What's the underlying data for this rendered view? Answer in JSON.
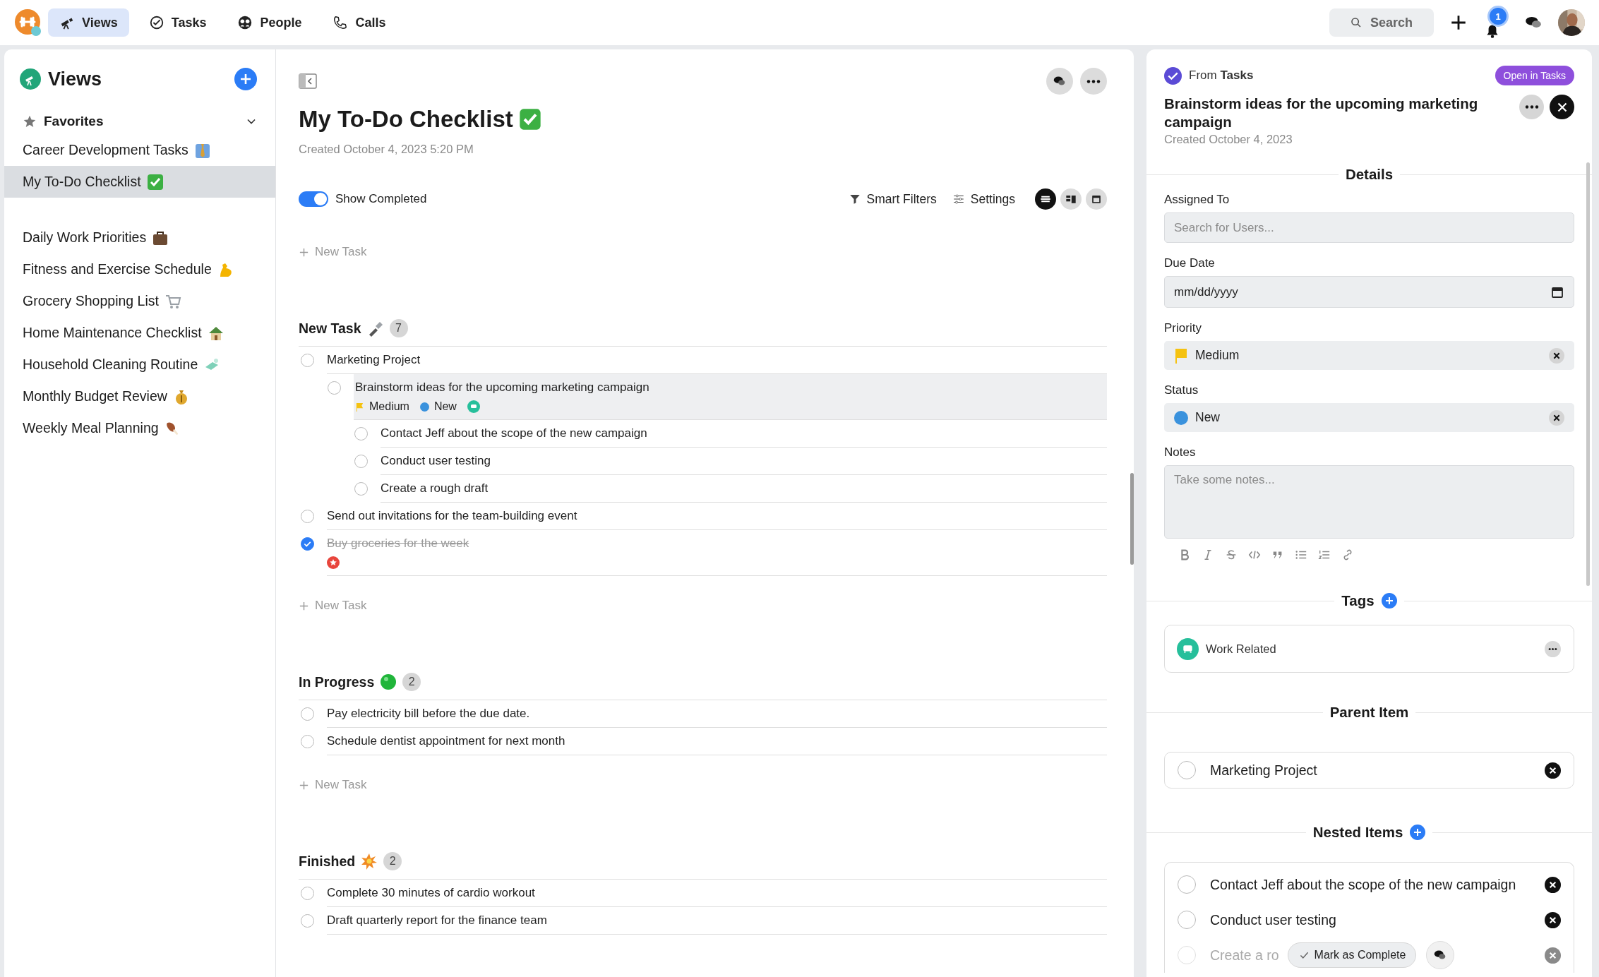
{
  "top_nav": {
    "tabs": [
      {
        "label": "Views",
        "selected": true
      },
      {
        "label": "Tasks",
        "selected": false
      },
      {
        "label": "People",
        "selected": false
      },
      {
        "label": "Calls",
        "selected": false
      }
    ],
    "search": {
      "label": "Search"
    },
    "notification_count": "1"
  },
  "sidebar": {
    "title": "Views",
    "favorites": {
      "label": "Favorites",
      "expanded": true,
      "items": [
        {
          "label": "Career Development Tasks",
          "selected": false
        },
        {
          "label": "My To-Do Checklist",
          "selected": true
        }
      ]
    },
    "items": [
      {
        "label": "Daily Work Priorities",
        "selected": false
      },
      {
        "label": "Fitness and Exercise Schedule",
        "selected": false
      },
      {
        "label": "Grocery Shopping List",
        "selected": false
      },
      {
        "label": "Home Maintenance Checklist",
        "selected": false
      },
      {
        "label": "Household Cleaning Routine",
        "selected": false
      },
      {
        "label": "Monthly Budget Review",
        "selected": false
      },
      {
        "label": "Weekly Meal Planning",
        "selected": false
      }
    ]
  },
  "list": {
    "title": "My To-Do Checklist",
    "created": "Created October 4, 2023 5:20 PM",
    "show_completed": {
      "label": "Show Completed",
      "on": true
    },
    "smart_filters": "Smart Filters",
    "settings": "Settings",
    "view_modes": [
      {
        "selected": true
      },
      {
        "selected": false
      },
      {
        "selected": false
      }
    ],
    "new_task": "New Task",
    "groups": [
      {
        "title": "New Task",
        "count": "7",
        "new_task": "New Task",
        "tasks": [
          {
            "title": "Marketing Project",
            "checked": false,
            "selected": false,
            "important": false,
            "children": [
              {
                "title": "Brainstorm ideas for the upcoming marketing campaign",
                "checked": false,
                "selected": true,
                "important": false,
                "priority": {
                  "label": "Medium",
                  "color": "#f5c211"
                },
                "status": {
                  "label": "New",
                  "color": "#3a92dd"
                },
                "tags": [
                  {
                    "color": "#26bf9b"
                  }
                ],
                "children": [
                  {
                    "title": "Contact Jeff about the scope of the new campaign",
                    "checked": false,
                    "selected": false,
                    "important": false
                  },
                  {
                    "title": "Conduct user testing",
                    "checked": false,
                    "selected": false,
                    "important": false
                  },
                  {
                    "title": "Create a rough draft",
                    "checked": false,
                    "selected": false,
                    "important": false
                  }
                ]
              }
            ]
          },
          {
            "title": "Send out invitations for the team-building event",
            "checked": false,
            "selected": false,
            "important": false
          },
          {
            "title": "Buy groceries for the week",
            "checked": true,
            "selected": false,
            "important": true
          }
        ]
      },
      {
        "title": "In Progress",
        "count": "2",
        "new_task": "New Task",
        "tasks": [
          {
            "title": "Pay electricity bill before the due date.",
            "checked": false,
            "selected": false,
            "important": false
          },
          {
            "title": "Schedule dentist appointment for next month",
            "checked": false,
            "selected": false,
            "important": false
          }
        ]
      },
      {
        "title": "Finished",
        "count": "2",
        "tasks": [
          {
            "title": "Complete 30 minutes of cardio workout",
            "checked": false,
            "selected": false,
            "important": false
          },
          {
            "title": "Draft quarterly report for the finance team",
            "checked": false,
            "selected": false,
            "important": false
          }
        ]
      }
    ]
  },
  "detail": {
    "source_prefix": "From",
    "source_app": "Tasks",
    "open_button": "Open in Tasks",
    "title": "Brainstorm ideas for the upcoming marketing campaign",
    "created": "Created October 4, 2023",
    "details_heading": "Details",
    "assigned_to": {
      "label": "Assigned To",
      "placeholder": "Search for Users..."
    },
    "due_date": {
      "label": "Due Date",
      "placeholder": "mm/dd/yyyy"
    },
    "priority": {
      "label": "Priority",
      "value": "Medium",
      "color": "#f5c211"
    },
    "status": {
      "label": "Status",
      "value": "New",
      "color": "#3a92dd"
    },
    "notes": {
      "label": "Notes",
      "placeholder": "Take some notes..."
    },
    "tags": {
      "heading": "Tags",
      "items": [
        {
          "label": "Work Related",
          "color": "#26bf9b"
        }
      ]
    },
    "parent_item": {
      "heading": "Parent Item",
      "items": [
        {
          "title": "Marketing Project",
          "checked": false
        }
      ]
    },
    "nested_items": {
      "heading": "Nested Items",
      "mark_complete": "Mark as Complete",
      "items": [
        {
          "title": "Contact Jeff about the scope of the new campaign",
          "checked": false,
          "hovered": false
        },
        {
          "title": "Conduct user testing",
          "checked": false,
          "hovered": false
        },
        {
          "title": "Create a ro",
          "checked": false,
          "hovered": true
        }
      ]
    }
  }
}
